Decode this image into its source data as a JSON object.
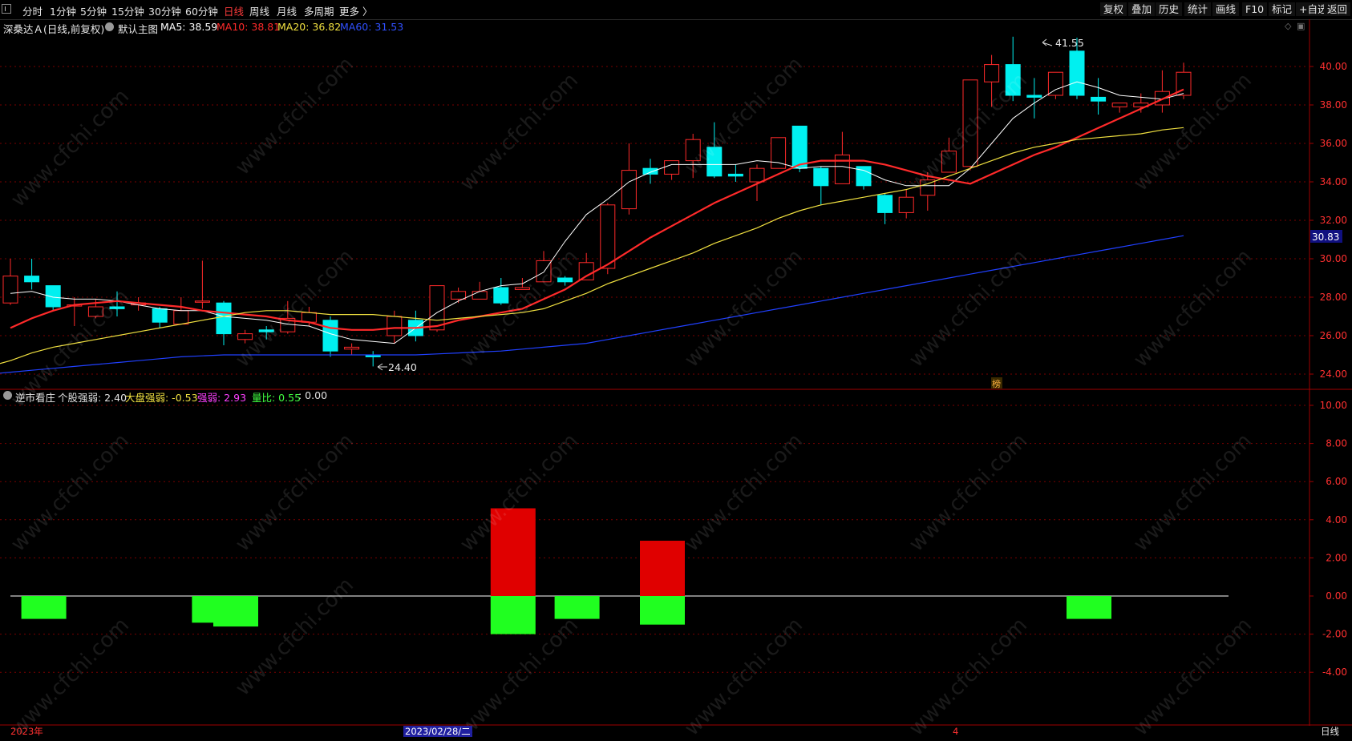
{
  "toolbar": {
    "left_items": [
      "分时",
      "1分钟",
      "5分钟",
      "15分钟",
      "30分钟",
      "60分钟",
      "日线",
      "周线",
      "月线",
      "多周期",
      "更多 〉"
    ],
    "active_item": "日线",
    "right_items": [
      "复权",
      "叠加",
      "历史",
      "统计",
      "画线",
      "F10",
      "标记",
      "+自选",
      "返回"
    ]
  },
  "stock_header": {
    "title": "深桑达Ａ(日线,前复权)",
    "main_chart_label": "默认主图",
    "ma": [
      {
        "label": "MA5: 38.59",
        "color": "#ffffff"
      },
      {
        "label": "MA10: 38.81",
        "color": "#ff2a2a"
      },
      {
        "label": "MA20: 36.82",
        "color": "#f0e040"
      },
      {
        "label": "MA60: 31.53",
        "color": "#3050ff"
      }
    ]
  },
  "indicator_header": {
    "name": "逆市看庄",
    "items": [
      {
        "label": "个股强弱: 2.40",
        "color": "#e0e0e0"
      },
      {
        "label": "大盘强弱: -0.53",
        "color": "#f0e040"
      },
      {
        "label": "强弱: 2.93",
        "color": "#ff40ff"
      },
      {
        "label": "量比: 0.55",
        "color": "#40ff40"
      },
      {
        "label": ": 0.00",
        "color": "#e0e0e0"
      }
    ]
  },
  "price_axis": {
    "labels": [
      "40.00",
      "38.00",
      "36.00",
      "34.00",
      "32.00",
      "30.00",
      "28.00",
      "26.00",
      "24.00"
    ],
    "current_price_tag": "30.83",
    "high_annotation": "41.55",
    "low_annotation": "24.40",
    "badge": "榜"
  },
  "indicator_axis": {
    "labels": [
      "10.00",
      "8.00",
      "6.00",
      "4.00",
      "2.00",
      "0.00",
      "-2.00",
      "-4.00"
    ]
  },
  "bottom": {
    "date_labels": [
      {
        "text": "2023年",
        "color": "#ff3030"
      },
      {
        "text": "2023/02/28/二",
        "color": "#ffffff"
      },
      {
        "text": "4",
        "color": "#ff3030"
      }
    ],
    "period_label": "日线"
  },
  "watermark_text": "www.cfchi.com",
  "colors": {
    "up": "#ff2a2a",
    "down": "#00f0f0",
    "ma5": "#ffffff",
    "ma10": "#ff2a2a",
    "ma20": "#f0e040",
    "ma60": "#2040ff",
    "grid": "#7a0000",
    "bar_red": "#e00000",
    "bar_green": "#20ff20"
  },
  "chart_data": {
    "type": "candlestick",
    "series": [
      {
        "name": "K线",
        "ohlc": [
          [
            27.7,
            29.1,
            27.6,
            30.0
          ],
          [
            29.1,
            28.8,
            28.4,
            30.0
          ],
          [
            28.6,
            27.5,
            27.3,
            28.6
          ],
          [
            27.6,
            27.6,
            26.5,
            28.0
          ],
          [
            27.0,
            27.5,
            26.9,
            27.9
          ],
          [
            27.5,
            27.4,
            27.0,
            28.3
          ],
          [
            27.6,
            27.7,
            27.3,
            28.0
          ],
          [
            27.4,
            26.7,
            26.4,
            27.5
          ],
          [
            26.6,
            27.3,
            26.6,
            28.0
          ],
          [
            27.8,
            27.8,
            27.4,
            29.9
          ],
          [
            27.7,
            26.1,
            25.5,
            27.8
          ],
          [
            25.8,
            26.1,
            25.6,
            26.3
          ],
          [
            26.3,
            26.2,
            25.8,
            26.5
          ],
          [
            26.2,
            26.9,
            26.1,
            27.8
          ],
          [
            26.7,
            27.2,
            26.5,
            27.5
          ],
          [
            26.8,
            25.2,
            24.9,
            27.0
          ],
          [
            25.3,
            25.4,
            25.0,
            25.6
          ],
          [
            25.0,
            24.9,
            24.4,
            25.2
          ],
          [
            26.0,
            27.0,
            25.6,
            27.3
          ],
          [
            26.8,
            26.0,
            25.7,
            27.3
          ],
          [
            26.3,
            28.6,
            26.2,
            28.6
          ],
          [
            27.9,
            28.3,
            27.7,
            28.5
          ],
          [
            27.9,
            28.3,
            27.9,
            28.8
          ],
          [
            28.5,
            27.7,
            27.6,
            29.0
          ],
          [
            28.4,
            28.5,
            28.4,
            29.0
          ],
          [
            28.8,
            29.9,
            28.9,
            30.4
          ],
          [
            29.0,
            28.8,
            28.6,
            29.1
          ],
          [
            28.9,
            29.8,
            28.9,
            30.3
          ],
          [
            29.5,
            32.8,
            29.2,
            32.9
          ],
          [
            32.6,
            34.6,
            32.3,
            36.0
          ],
          [
            34.7,
            34.4,
            33.9,
            35.2
          ],
          [
            34.4,
            35.1,
            34.1,
            35.1
          ],
          [
            35.1,
            36.2,
            34.2,
            36.5
          ],
          [
            35.8,
            34.3,
            34.2,
            37.1
          ],
          [
            34.4,
            34.3,
            34.0,
            34.9
          ],
          [
            34.0,
            34.7,
            33.0,
            34.9
          ],
          [
            34.7,
            36.3,
            34.7,
            36.3
          ],
          [
            36.9,
            34.7,
            34.5,
            36.9
          ],
          [
            34.7,
            33.8,
            32.8,
            34.8
          ],
          [
            33.9,
            35.4,
            33.9,
            36.6
          ],
          [
            34.8,
            33.8,
            33.6,
            34.8
          ],
          [
            33.3,
            32.4,
            31.8,
            33.4
          ],
          [
            32.4,
            33.2,
            32.1,
            33.6
          ],
          [
            33.3,
            34.1,
            32.5,
            34.5
          ],
          [
            34.5,
            35.6,
            34.5,
            36.3
          ],
          [
            34.8,
            39.3,
            34.6,
            39.3
          ],
          [
            39.2,
            40.1,
            37.9,
            40.6
          ],
          [
            40.1,
            38.5,
            38.2,
            41.55
          ],
          [
            38.5,
            38.4,
            37.3,
            39.4
          ],
          [
            38.5,
            39.7,
            38.3,
            39.7
          ],
          [
            40.8,
            38.5,
            38.3,
            41.5
          ],
          [
            38.4,
            38.2,
            37.5,
            39.4
          ],
          [
            37.9,
            38.1,
            37.6,
            38.1
          ],
          [
            37.9,
            38.1,
            37.6,
            38.6
          ],
          [
            38.0,
            38.7,
            37.6,
            39.8
          ],
          [
            38.5,
            39.7,
            38.3,
            40.2
          ]
        ]
      },
      {
        "name": "MA5",
        "values": [
          28.2,
          28.3,
          28.0,
          27.9,
          27.9,
          27.8,
          27.6,
          27.4,
          27.3,
          27.3,
          27.0,
          26.9,
          26.8,
          26.6,
          26.5,
          26.1,
          25.8,
          25.7,
          25.6,
          26.4,
          27.2,
          27.8,
          28.3,
          28.6,
          28.7,
          29.3,
          30.9,
          32.3,
          33.1,
          34.0,
          34.5,
          34.9,
          34.9,
          34.9,
          34.9,
          35.1,
          35.0,
          34.7,
          34.8,
          34.8,
          34.6,
          34.1,
          33.8,
          33.8,
          33.8,
          34.7,
          36.0,
          37.3,
          38.1,
          38.8,
          39.2,
          38.9,
          38.5,
          38.4,
          38.3,
          38.6
        ]
      },
      {
        "name": "MA10",
        "values": [
          26.4,
          26.9,
          27.3,
          27.6,
          27.7,
          27.8,
          27.7,
          27.6,
          27.5,
          27.3,
          27.2,
          27.1,
          27.0,
          26.8,
          26.7,
          26.4,
          26.3,
          26.3,
          26.4,
          26.4,
          26.5,
          26.8,
          27.0,
          27.2,
          27.4,
          27.9,
          28.4,
          29.1,
          29.7,
          30.4,
          31.1,
          31.7,
          32.3,
          32.9,
          33.4,
          33.9,
          34.4,
          34.9,
          35.1,
          35.1,
          35.1,
          34.9,
          34.6,
          34.3,
          34.1,
          33.9,
          34.4,
          34.9,
          35.4,
          35.8,
          36.3,
          36.8,
          37.3,
          37.8,
          38.3,
          38.81
        ]
      },
      {
        "name": "MA20",
        "values": [
          24.7,
          25.1,
          25.4,
          25.6,
          25.8,
          26.0,
          26.2,
          26.4,
          26.6,
          26.8,
          27.0,
          27.2,
          27.3,
          27.3,
          27.2,
          27.1,
          27.1,
          27.1,
          27.0,
          26.9,
          26.8,
          26.9,
          27.0,
          27.1,
          27.2,
          27.4,
          27.8,
          28.2,
          28.7,
          29.1,
          29.5,
          29.9,
          30.3,
          30.8,
          31.2,
          31.6,
          32.1,
          32.5,
          32.8,
          33.0,
          33.2,
          33.4,
          33.6,
          33.9,
          34.3,
          34.7,
          35.1,
          35.5,
          35.8,
          36.0,
          36.2,
          36.3,
          36.4,
          36.5,
          36.7,
          36.82
        ]
      },
      {
        "name": "MA60",
        "values": [
          24.1,
          24.2,
          24.3,
          24.4,
          24.5,
          24.6,
          24.7,
          24.8,
          24.9,
          24.95,
          25.0,
          25.0,
          25.0,
          25.0,
          25.0,
          25.0,
          25.0,
          25.0,
          25.0,
          25.0,
          25.05,
          25.1,
          25.15,
          25.2,
          25.3,
          25.4,
          25.5,
          25.6,
          25.8,
          26.0,
          26.2,
          26.4,
          26.6,
          26.8,
          27.0,
          27.2,
          27.4,
          27.6,
          27.8,
          28.0,
          28.2,
          28.4,
          28.6,
          28.8,
          29.0,
          29.2,
          29.4,
          29.6,
          29.8,
          30.0,
          30.2,
          30.4,
          30.6,
          30.8,
          31.0,
          31.2
        ]
      },
      {
        "name": "逆市看庄",
        "bars": [
          {
            "index": 1,
            "value": -1.2,
            "color": "green"
          },
          {
            "index": 9,
            "value": -1.4,
            "color": "green"
          },
          {
            "index": 10,
            "value": -1.6,
            "color": "green"
          },
          {
            "index": 23,
            "value": 4.6,
            "color": "red"
          },
          {
            "index": 23,
            "value": -2.0,
            "color": "green"
          },
          {
            "index": 26,
            "value": -1.2,
            "color": "green"
          },
          {
            "index": 30,
            "value": 2.9,
            "color": "red"
          },
          {
            "index": 30,
            "value": -1.5,
            "color": "green"
          },
          {
            "index": 50,
            "value": -1.2,
            "color": "green"
          }
        ]
      }
    ],
    "ylim_price": [
      24.0,
      41.0
    ],
    "ylim_indicator": [
      -4.0,
      10.0
    ]
  }
}
